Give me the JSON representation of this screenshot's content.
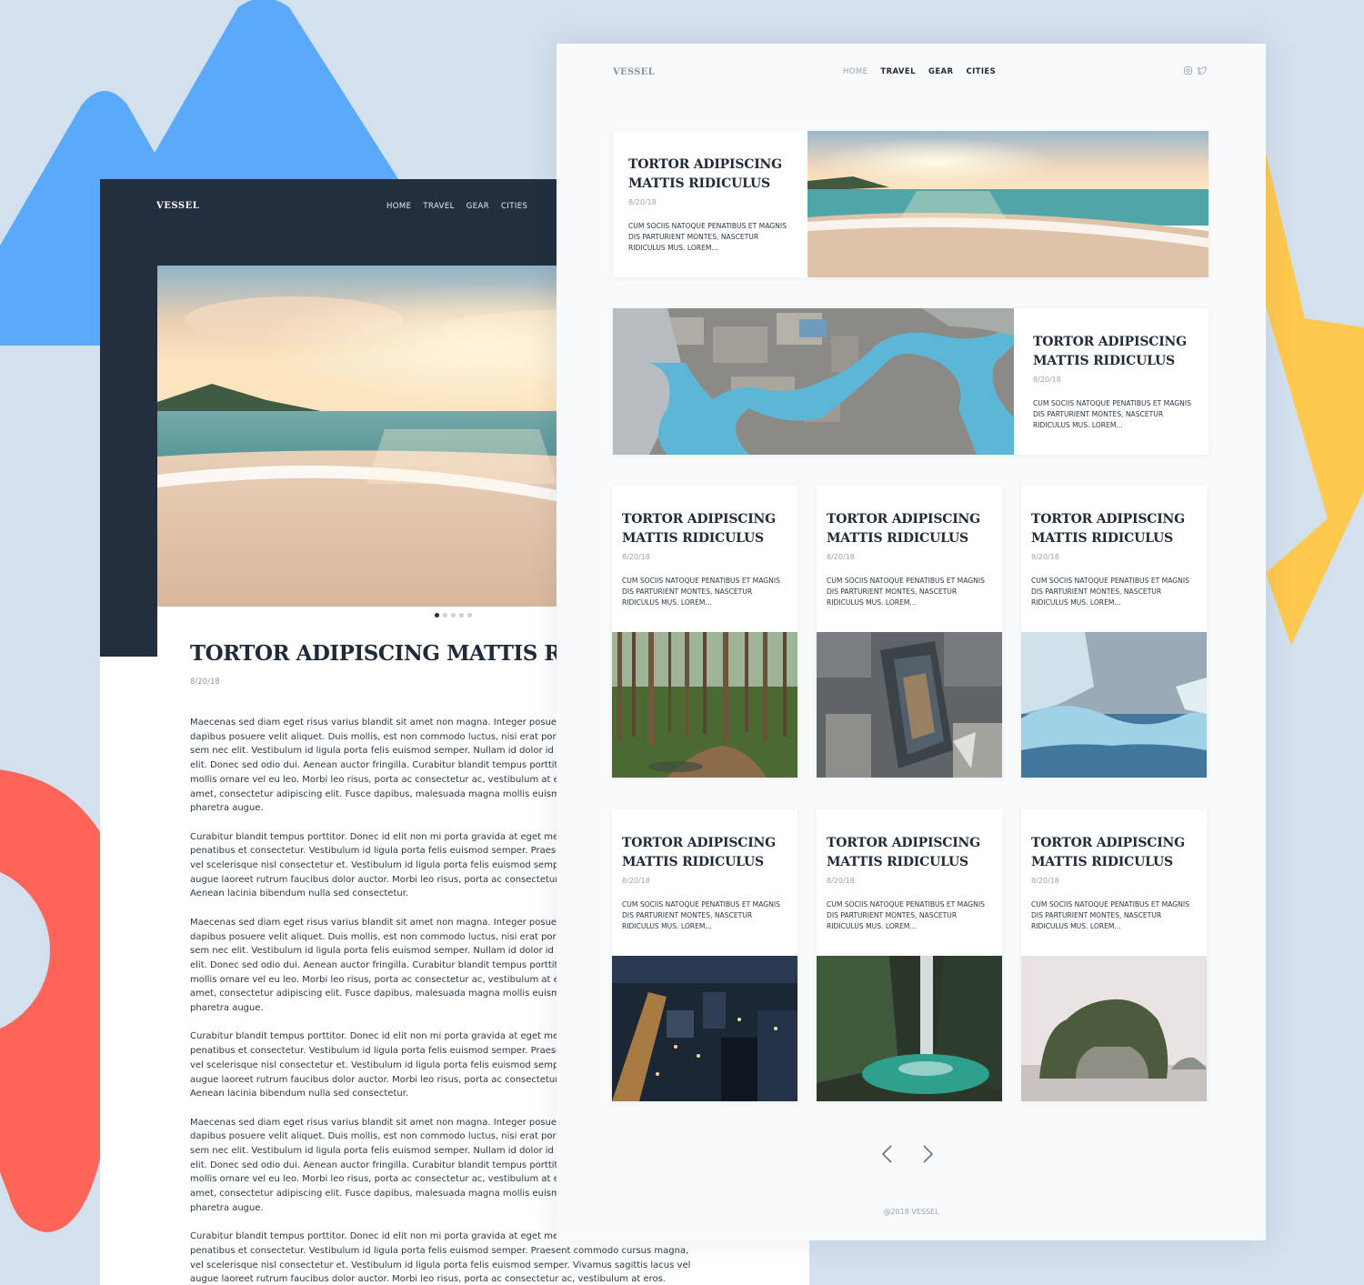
{
  "brand": "VESSEL",
  "nav": {
    "items": [
      "HOME",
      "TRAVEL",
      "GEAR",
      "CITIES"
    ],
    "current": "HOME"
  },
  "socials": [
    "instagram-icon",
    "twitter-icon"
  ],
  "article": {
    "title": "TORTOR ADIPISCING MATTIS RIDICULUS",
    "date": "8/20/18",
    "slide_count": 5,
    "active_slide": 1,
    "paragraphs": [
      "Maecenas sed diam eget risus varius blandit sit amet non magna. Integer posuere erat a ante venenatis dapibus posuere velit aliquet. Duis mollis, est non commodo luctus, nisi erat porttitor ligula, eget lacinia odio sem nec elit. Vestibulum id ligula porta felis euismod semper. Nullam id dolor id nibh ultricies vehicula ut id elit. Donec sed odio dui. Aenean auctor fringilla. Curabitur blandit tempus porttitor. Nullam quis risus eget urna mollis ornare vel eu leo. Morbi leo risus, porta ac consectetur ac, vestibulum at eros. Lorem ipsum dolor sit amet, consectetur adipiscing elit. Fusce dapibus, malesuada magna mollis euismod. Nulla vitae elit libero, a pharetra augue.",
      "Curabitur blandit tempus porttitor. Donec id elit non mi porta gravida at eget metus. Cum sociis natoque penatibus et consectetur. Vestibulum id ligula porta felis euismod semper. Praesent commodo cursus magna, vel scelerisque nisl consectetur et. Vestibulum id ligula porta felis euismod semper. Vivamus sagittis lacus vel augue laoreet rutrum faucibus dolor auctor. Morbi leo risus, porta ac consectetur ac, vestibulum at eros. Aenean lacinia bibendum nulla sed consectetur.",
      "Maecenas sed diam eget risus varius blandit sit amet non magna. Integer posuere erat a ante venenatis dapibus posuere velit aliquet. Duis mollis, est non commodo luctus, nisi erat porttitor ligula, eget lacinia odio sem nec elit. Vestibulum id ligula porta felis euismod semper. Nullam id dolor id nibh ultricies vehicula ut id elit. Donec sed odio dui. Aenean auctor fringilla. Curabitur blandit tempus porttitor. Nullam quis risus eget urna mollis ornare vel eu leo. Morbi leo risus, porta ac consectetur ac, vestibulum at eros. Lorem ipsum dolor sit amet, consectetur adipiscing elit. Fusce dapibus, malesuada magna mollis euismod. Nulla vitae elit libero, a pharetra augue.",
      "Curabitur blandit tempus porttitor. Donec id elit non mi porta gravida at eget metus. Cum sociis natoque penatibus et consectetur. Vestibulum id ligula porta felis euismod semper. Praesent commodo cursus magna, vel scelerisque nisl consectetur et. Vestibulum id ligula porta felis euismod semper. Vivamus sagittis lacus vel augue laoreet rutrum faucibus dolor auctor. Morbi leo risus, porta ac consectetur ac, vestibulum at eros. Aenean lacinia bibendum nulla sed consectetur.",
      "Maecenas sed diam eget risus varius blandit sit amet non magna. Integer posuere erat a ante venenatis dapibus posuere velit aliquet. Duis mollis, est non commodo luctus, nisi erat porttitor ligula, eget lacinia odio sem nec elit. Vestibulum id ligula porta felis euismod semper. Nullam id dolor id nibh ultricies vehicula ut id elit. Donec sed odio dui. Aenean auctor fringilla. Curabitur blandit tempus porttitor. Nullam quis risus eget urna mollis ornare vel eu leo. Morbi leo risus, porta ac consectetur ac, vestibulum at eros. Lorem ipsum dolor sit amet, consectetur adipiscing elit. Fusce dapibus, malesuada magna mollis euismod. Nulla vitae elit libero, a pharetra augue.",
      "Curabitur blandit tempus porttitor. Donec id elit non mi porta gravida at eget metus. Cum sociis natoque penatibus et consectetur. Vestibulum id ligula porta felis euismod semper. Praesent commodo cursus magna, vel scelerisque nisl consectetur et. Vestibulum id ligula porta felis euismod semper. Vivamus sagittis lacus vel augue laoreet rutrum faucibus dolor auctor. Morbi leo risus, porta ac consectetur ac, vestibulum at eros. Aenean lacinia bibendum nulla sed consectetur."
    ]
  },
  "posts": [
    {
      "title": "TORTOR ADIPISCING MATTIS RIDICULUS",
      "date": "8/20/18",
      "excerpt": "CUM SOCIIS NATOQUE PENATIBUS ET MAGNIS DIS PARTURIENT MONTES, NASCETUR RIDICULUS MUS. LOREM...",
      "image": "beach-sunset-image"
    },
    {
      "title": "TORTOR ADIPISCING MATTIS RIDICULUS",
      "date": "8/20/18",
      "excerpt": "CUM SOCIIS NATOQUE PENATIBUS ET MAGNIS DIS PARTURIENT MONTES, NASCETUR RIDICULUS MUS. LOREM...",
      "image": "aerial-city-water-image"
    },
    {
      "title": "TORTOR ADIPISCING MATTIS RIDICULUS",
      "date": "8/20/18",
      "excerpt": "CUM SOCIIS NATOQUE PENATIBUS ET MAGNIS DIS PARTURIENT MONTES, NASCETUR RIDICULUS MUS. LOREM...",
      "image": "forest-image"
    },
    {
      "title": "TORTOR ADIPISCING MATTIS RIDICULUS",
      "date": "8/20/18",
      "excerpt": "CUM SOCIIS NATOQUE PENATIBUS ET MAGNIS DIS PARTURIENT MONTES, NASCETUR RIDICULUS MUS. LOREM...",
      "image": "skyscraper-aerial-image"
    },
    {
      "title": "TORTOR ADIPISCING MATTIS RIDICULUS",
      "date": "8/20/18",
      "excerpt": "CUM SOCIIS NATOQUE PENATIBUS ET MAGNIS DIS PARTURIENT MONTES, NASCETUR RIDICULUS MUS. LOREM...",
      "image": "glacier-image"
    },
    {
      "title": "TORTOR ADIPISCING MATTIS RIDICULUS",
      "date": "8/20/18",
      "excerpt": "CUM SOCIIS NATOQUE PENATIBUS ET MAGNIS DIS PARTURIENT MONTES, NASCETUR RIDICULUS MUS. LOREM...",
      "image": "city-night-image"
    },
    {
      "title": "TORTOR ADIPISCING MATTIS RIDICULUS",
      "date": "8/20/18",
      "excerpt": "CUM SOCIIS NATOQUE PENATIBUS ET MAGNIS DIS PARTURIENT MONTES, NASCETUR RIDICULUS MUS. LOREM...",
      "image": "waterfall-image"
    },
    {
      "title": "TORTOR ADIPISCING MATTIS RIDICULUS",
      "date": "8/20/18",
      "excerpt": "CUM SOCIIS NATOQUE PENATIBUS ET MAGNIS DIS PARTURIENT MONTES, NASCETUR RIDICULUS MUS. LOREM...",
      "image": "karst-island-image"
    }
  ],
  "pagination": {
    "prev_icon": "chevron-left-icon",
    "next_icon": "chevron-right-icon"
  },
  "footer": "@2018 VESSEL",
  "colors": {
    "background": "#d3e0ed",
    "dark_header": "#232f3e",
    "text": "#1f2b38",
    "muted": "#9aa3ad",
    "deco_blue": "#5aa9fb",
    "deco_yellow": "#ffc94f",
    "deco_red": "#ff6459"
  }
}
